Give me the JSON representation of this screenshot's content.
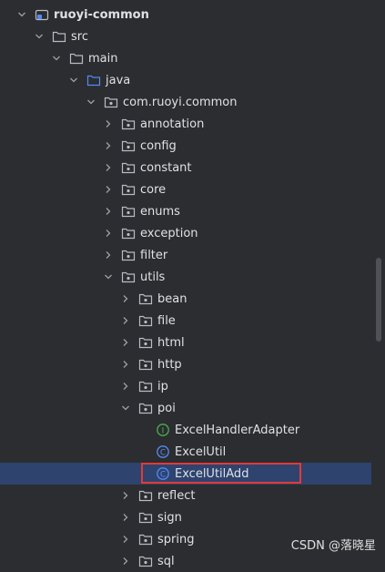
{
  "tree": [
    {
      "label": "ruoyi-common",
      "depth": 0,
      "chevron": "down",
      "icon": "module",
      "bold": true
    },
    {
      "label": "src",
      "depth": 1,
      "chevron": "down",
      "icon": "folder"
    },
    {
      "label": "main",
      "depth": 2,
      "chevron": "down",
      "icon": "folder"
    },
    {
      "label": "java",
      "depth": 3,
      "chevron": "down",
      "icon": "source-folder"
    },
    {
      "label": "com.ruoyi.common",
      "depth": 4,
      "chevron": "down",
      "icon": "package"
    },
    {
      "label": "annotation",
      "depth": 5,
      "chevron": "right",
      "icon": "package"
    },
    {
      "label": "config",
      "depth": 5,
      "chevron": "right",
      "icon": "package"
    },
    {
      "label": "constant",
      "depth": 5,
      "chevron": "right",
      "icon": "package"
    },
    {
      "label": "core",
      "depth": 5,
      "chevron": "right",
      "icon": "package"
    },
    {
      "label": "enums",
      "depth": 5,
      "chevron": "right",
      "icon": "package"
    },
    {
      "label": "exception",
      "depth": 5,
      "chevron": "right",
      "icon": "package"
    },
    {
      "label": "filter",
      "depth": 5,
      "chevron": "right",
      "icon": "package"
    },
    {
      "label": "utils",
      "depth": 5,
      "chevron": "down",
      "icon": "package"
    },
    {
      "label": "bean",
      "depth": 6,
      "chevron": "right",
      "icon": "package"
    },
    {
      "label": "file",
      "depth": 6,
      "chevron": "right",
      "icon": "package"
    },
    {
      "label": "html",
      "depth": 6,
      "chevron": "right",
      "icon": "package"
    },
    {
      "label": "http",
      "depth": 6,
      "chevron": "right",
      "icon": "package"
    },
    {
      "label": "ip",
      "depth": 6,
      "chevron": "right",
      "icon": "package"
    },
    {
      "label": "poi",
      "depth": 6,
      "chevron": "down",
      "icon": "package"
    },
    {
      "label": "ExcelHandlerAdapter",
      "depth": 7,
      "chevron": "none",
      "icon": "interface"
    },
    {
      "label": "ExcelUtil",
      "depth": 7,
      "chevron": "none",
      "icon": "class"
    },
    {
      "label": "ExcelUtilAdd",
      "depth": 7,
      "chevron": "none",
      "icon": "class",
      "selected": true
    },
    {
      "label": "reflect",
      "depth": 6,
      "chevron": "right",
      "icon": "package"
    },
    {
      "label": "sign",
      "depth": 6,
      "chevron": "right",
      "icon": "package"
    },
    {
      "label": "spring",
      "depth": 6,
      "chevron": "right",
      "icon": "package"
    },
    {
      "label": "sql",
      "depth": 6,
      "chevron": "right",
      "icon": "package"
    }
  ],
  "watermark": "CSDN @落晓星",
  "colors": {
    "background": "#2b2d30",
    "selection": "#2e436e",
    "highlight_border": "#e53935",
    "interface_icon": "#4caf50",
    "class_icon": "#548af7"
  }
}
